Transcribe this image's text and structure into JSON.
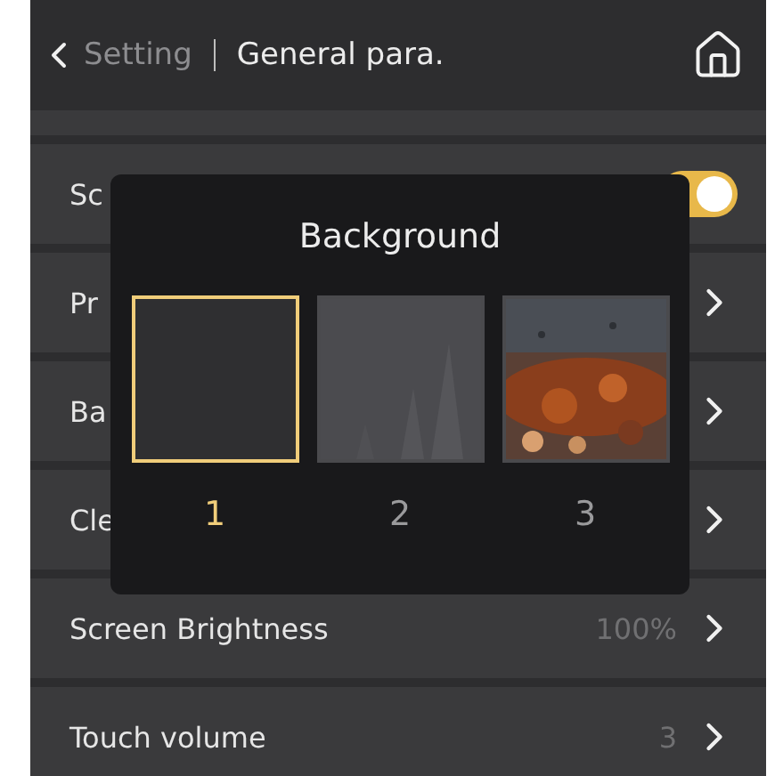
{
  "header": {
    "back_label": "Setting",
    "title": "General para."
  },
  "rows": [
    {
      "kind": "partial"
    },
    {
      "kind": "toggle",
      "label": "Sc",
      "on": true
    },
    {
      "kind": "link",
      "label": "Pr"
    },
    {
      "kind": "link",
      "label": "Ba"
    },
    {
      "kind": "link",
      "label": "Cle"
    },
    {
      "kind": "link",
      "label": "Screen Brightness",
      "value": "100%"
    },
    {
      "kind": "link",
      "label": "Touch volume",
      "value": "3"
    }
  ],
  "dialog": {
    "title": "Background",
    "options": [
      {
        "label": "1",
        "kind": "plain",
        "selected": true
      },
      {
        "label": "2",
        "kind": "picture",
        "selected": false
      },
      {
        "label": "3",
        "kind": "picture",
        "selected": false
      }
    ]
  }
}
